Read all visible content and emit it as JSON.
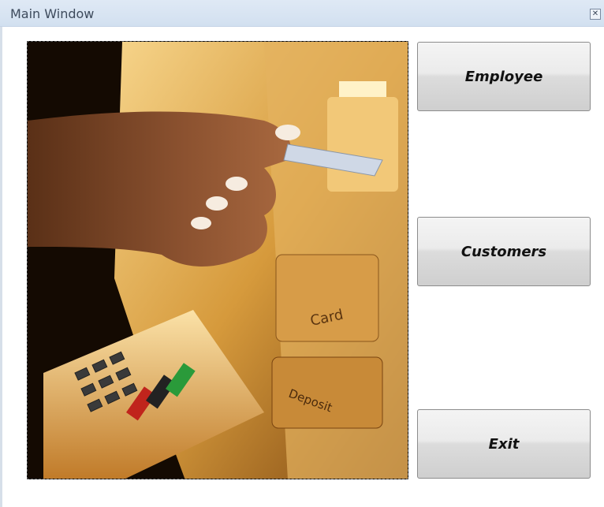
{
  "window": {
    "title": "Main Window",
    "close_icon": "close-icon"
  },
  "picture": {
    "subject": "atm-card-insert-image"
  },
  "buttons": {
    "employee": "Employee",
    "customers": "Customers",
    "exit": "Exit"
  }
}
